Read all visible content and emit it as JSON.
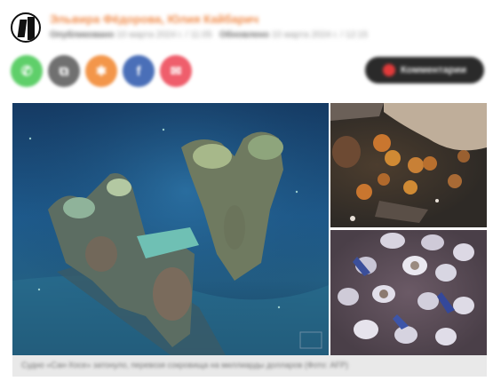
{
  "author": {
    "name": "Эльвира Фёдорова, Юлия Кайбарич",
    "published_label": "Опубликовано",
    "published_date": "10 марта 2024 г. / 11:05",
    "updated_label": "Обновлено",
    "updated_date": "10 марта 2024 г. / 12:15"
  },
  "share": {
    "buttons": [
      {
        "name": "whatsapp",
        "glyph": "✆",
        "color": "#5fcf6a"
      },
      {
        "name": "copy-link",
        "glyph": "⧉",
        "color": "#707070"
      },
      {
        "name": "ok",
        "glyph": "✱",
        "color": "#f3964a"
      },
      {
        "name": "facebook",
        "glyph": "f",
        "color": "#4a6fb8"
      },
      {
        "name": "gmail",
        "glyph": "✉",
        "color": "#ef5e6c"
      }
    ],
    "comments_label": "Комментарии"
  },
  "caption": {
    "text": "Судно «Сан-Хосе» затонуло, перевозя сокровища на миллиарды долларов (Фото: AFP)"
  }
}
